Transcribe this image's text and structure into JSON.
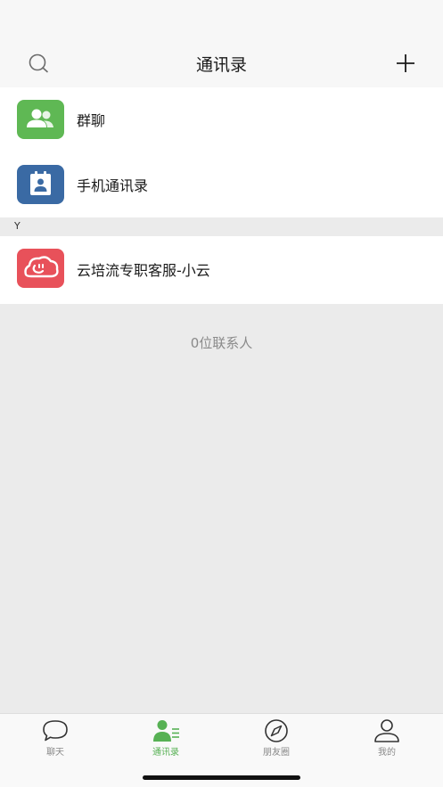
{
  "header": {
    "title": "通讯录"
  },
  "entries": [
    {
      "label": "群聊",
      "color": "#5fb854"
    },
    {
      "label": "手机通讯录",
      "color": "#3a6aa4"
    }
  ],
  "section": {
    "letter": "Y"
  },
  "contacts": [
    {
      "label": "云培流专职客服-小云",
      "color": "#e8515a"
    }
  ],
  "contact_count": "0位联系人",
  "tabs": [
    {
      "label": "聊天",
      "icon": "chat-bubble-icon",
      "active": false
    },
    {
      "label": "通讯录",
      "icon": "contacts-icon",
      "active": true
    },
    {
      "label": "朋友圈",
      "icon": "compass-icon",
      "active": false
    },
    {
      "label": "我的",
      "icon": "person-icon",
      "active": false
    }
  ],
  "colors": {
    "accent": "#57b154",
    "background": "#ebebeb"
  }
}
